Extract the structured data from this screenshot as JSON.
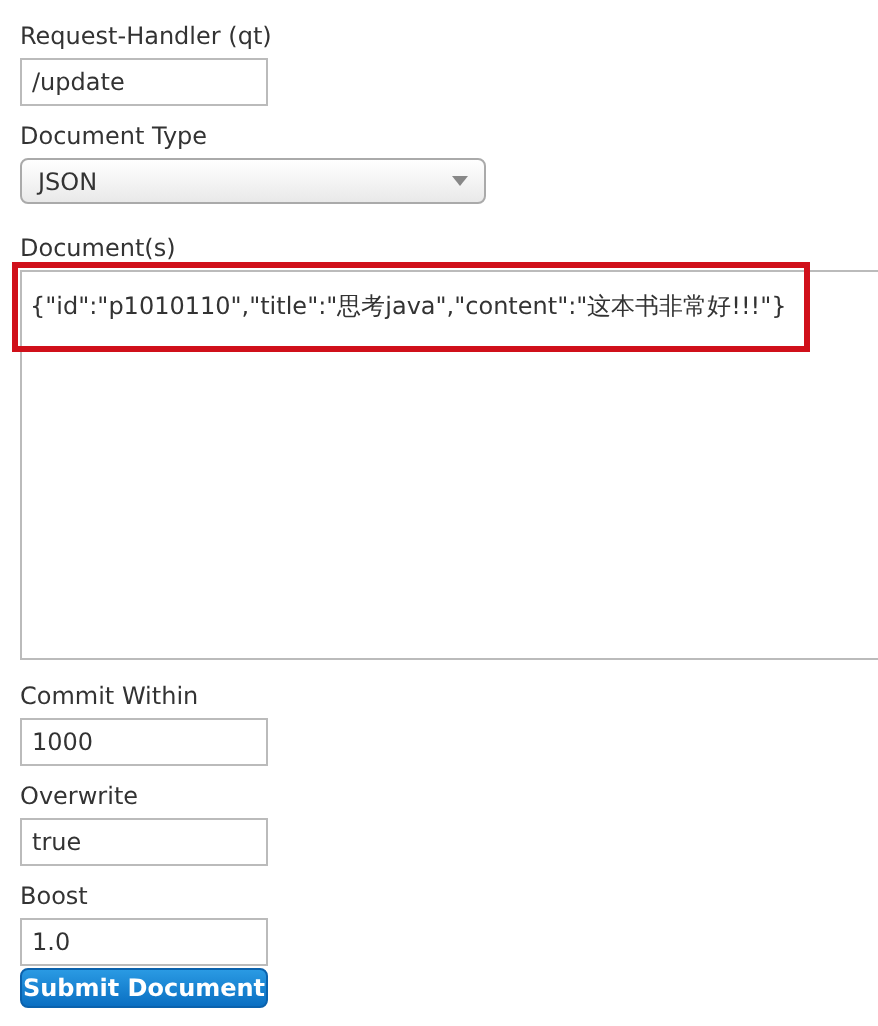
{
  "fields": [
    {
      "kind": "text",
      "label": "Request-Handler (qt)",
      "value": "/update"
    },
    {
      "kind": "select",
      "label": "Document Type",
      "value": "JSON"
    },
    {
      "kind": "textarea",
      "label": "Document(s)",
      "value": "{\"id\":\"p1010110\",\"title\":\"思考java\",\"content\":\"这本书非常好!!!\"}",
      "highlighted": true
    },
    {
      "kind": "text",
      "label": "Commit Within",
      "value": "1000"
    },
    {
      "kind": "text",
      "label": "Overwrite",
      "value": "true"
    },
    {
      "kind": "text",
      "label": "Boost",
      "value": "1.0"
    }
  ],
  "submit_button": "Submit Document"
}
